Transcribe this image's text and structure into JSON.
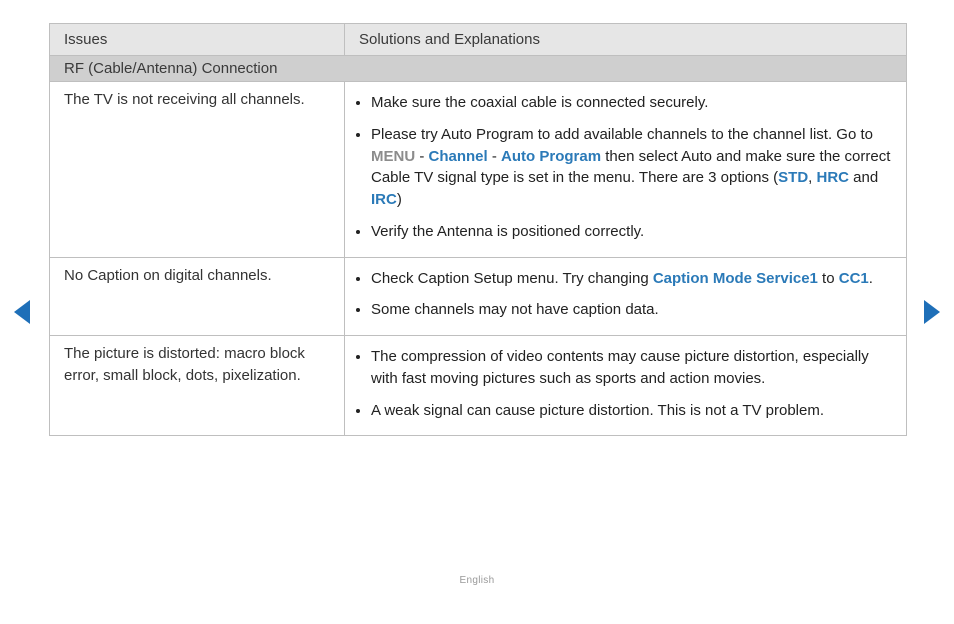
{
  "header": {
    "issues": "Issues",
    "solutions": "Solutions and Explanations"
  },
  "section": "RF (Cable/Antenna) Connection",
  "rows": [
    {
      "issue": "The TV is not receiving all channels.",
      "sol": {
        "b0": "Make sure the coaxial cable is connected securely.",
        "b1": {
          "t1": "Please try Auto Program to add available channels to the channel list. Go to ",
          "menu": "MENU",
          "dash1": " - ",
          "kw1": "Channel",
          "dash2": " - ",
          "kw2": "Auto Program",
          "t2": " then select Auto and make sure the correct Cable TV signal type is set in the menu. There are 3 options (",
          "kw3": "STD",
          "c1": ", ",
          "kw4": "HRC",
          "c2": " and ",
          "kw5": "IRC",
          "t3": ")"
        },
        "b2": "Verify the Antenna is positioned correctly."
      }
    },
    {
      "issue": "No Caption on digital channels.",
      "sol": {
        "b0": {
          "t1": "Check Caption Setup menu. Try changing ",
          "kw1": "Caption Mode Service1",
          "t2": " to ",
          "kw2": "CC1",
          "t3": "."
        },
        "b1": "Some channels may not have caption data."
      }
    },
    {
      "issue": "The picture is distorted: macro block error, small block, dots, pixelization.",
      "sol": {
        "b0": "The compression of video contents may cause picture distortion, especially with fast moving pictures such as sports and action movies.",
        "b1": "A weak signal can cause picture distortion. This is not a TV problem."
      }
    }
  ],
  "footer": {
    "language": "English"
  }
}
